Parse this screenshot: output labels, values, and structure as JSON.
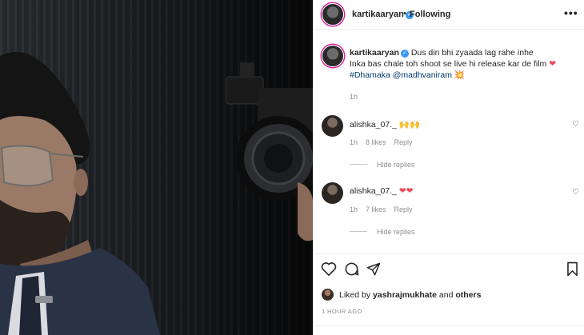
{
  "post": {
    "username": "kartikaaryan",
    "verified_symbol": "✓",
    "dot": "•",
    "follow_status": "Following",
    "more": "•••"
  },
  "caption": {
    "username": "kartikaaryan",
    "line1": "Dus din bhi zyaada lag rahe inhe",
    "line2": "Inka bas chale toh shoot se live hi release kar de film",
    "heart": "❤",
    "hashtag": "#Dhamaka",
    "mention": "@madhvaniram",
    "emoji": "💥",
    "time": "1h"
  },
  "comments": [
    {
      "username": "alishka_07._",
      "emoji": "🙌🙌",
      "time": "1h",
      "likes": "8 likes",
      "reply": "Reply",
      "hide_replies": "Hide replies",
      "like_icon": "♡"
    },
    {
      "username": "alishka_07._",
      "emoji": "❤❤",
      "time": "1h",
      "likes": "7 likes",
      "reply": "Reply",
      "hide_replies": "Hide replies",
      "like_icon": "♡"
    }
  ],
  "liked_by": {
    "prefix": "Liked by ",
    "user": "yashrajmukhate",
    "middle": " and ",
    "others": "others"
  },
  "timestamp": "1 HOUR AGO",
  "colors": {
    "verified": "#3897f0",
    "link": "#00376b",
    "heart": "#ed4956",
    "muted": "#8e8e8e",
    "border": "#efefef"
  }
}
